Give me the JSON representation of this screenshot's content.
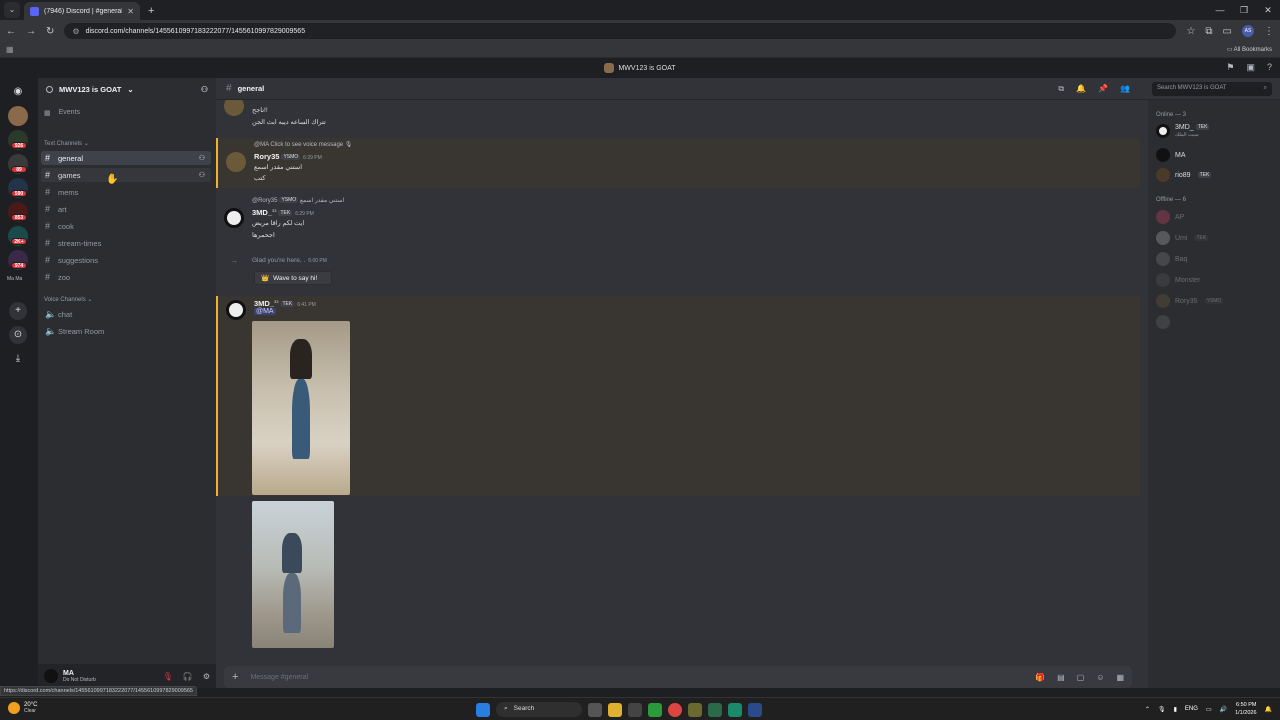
{
  "browser": {
    "tab_title": "(7946) Discord | #general | MW",
    "url": "discord.com/channels/1455610997183222077/1455610997829009565",
    "bookmarks_label": "All Bookmarks",
    "profile_initials": "AS",
    "status_url": "https://discord.com/channels/1455610997183222077/1455610997829009565"
  },
  "titlebar": {
    "server_name": "MWV123 is GOAT"
  },
  "rail": {
    "badges": [
      "926",
      "89",
      "590",
      "853",
      "2K+",
      "974"
    ],
    "small_label": "Ma Ma"
  },
  "sidebar": {
    "guild_name": "MWV123 is GOAT",
    "events_label": "Events",
    "text_category": "Text Channels",
    "voice_category": "Voice Channels",
    "text_channels": [
      "general",
      "games",
      "mems",
      "art",
      "cook",
      "stream-times",
      "suggestions",
      "zoo"
    ],
    "voice_channels": [
      "chat",
      "Stream Room"
    ]
  },
  "user": {
    "name": "MA",
    "status": "Do Not Disturb"
  },
  "header": {
    "channel": "general",
    "search_placeholder": "Search MWV123 is GOAT"
  },
  "messages": {
    "m0_line1": "ناجح!!",
    "m0_line2": "تتراك الساعه ديبه ابث الجن",
    "m1_reply": "@MA Click to see voice message",
    "m1_author": "Rory35",
    "m1_tag": "YSMO",
    "m1_time": "6:29 PM",
    "m1_line1": "استني مقدر اسمع",
    "m1_line2": "كتب",
    "m2_reply_user": "@Rory35",
    "m2_reply_tag": "YSMO",
    "m2_reply_text": "استني مقدر اسمع",
    "m2_author": "3MD_",
    "m2_author_sup": "33",
    "m2_tag": "TEK",
    "m2_time": "6:29 PM",
    "m2_line1": "ايت لكم راقا مريض",
    "m2_line2": "اجحمرها",
    "sys_text": "Glad you're here, .",
    "sys_time": "6:00 PM",
    "wave_label": "Wave to say hi!",
    "m3_author": "3MD_",
    "m3_author_sup": "33",
    "m3_tag": "TEK",
    "m3_time": "6:41 PM",
    "m3_mention": "@MA"
  },
  "composer": {
    "placeholder": "Message #general"
  },
  "members": {
    "online_header": "Online — 3",
    "offline_header": "Offline — 6",
    "online": [
      {
        "name": "3MD_",
        "tag": "TEK",
        "sub": "سبت الملك"
      },
      {
        "name": "MA",
        "tag": "",
        "sub": ""
      },
      {
        "name": "rio89",
        "tag": "TEK",
        "sub": ""
      }
    ],
    "offline": [
      {
        "name": "AP",
        "tag": ""
      },
      {
        "name": "Umi",
        "tag": "TEK"
      },
      {
        "name": "Baq",
        "tag": ""
      },
      {
        "name": "Monster",
        "tag": ""
      },
      {
        "name": "Rory35",
        "tag": "YSMO"
      },
      {
        "name": "",
        "tag": ""
      }
    ]
  },
  "taskbar": {
    "weather_temp": "20°C",
    "weather_desc": "Clear",
    "search": "Search",
    "lang": "ENG",
    "time": "6:50 PM",
    "date": "1/1/2026"
  }
}
